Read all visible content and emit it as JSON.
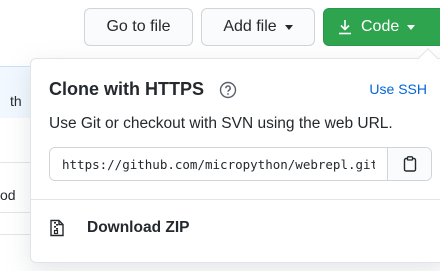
{
  "toolbar": {
    "goto_label": "Go to file",
    "add_label": "Add file",
    "code_label": "Code"
  },
  "background": {
    "fragments": [
      "th",
      "od"
    ]
  },
  "clone": {
    "title": "Clone with HTTPS",
    "alt_link": "Use SSH",
    "description": "Use Git or checkout with SVN using the web URL.",
    "url": "https://github.com/micropython/webrepl.git",
    "copy_icon": "clippy-icon",
    "help_icon": "question-icon"
  },
  "download": {
    "label": "Download ZIP",
    "icon": "file-zip-icon"
  },
  "colors": {
    "accent_green": "#2ea44f",
    "link_blue": "#0366d6"
  }
}
